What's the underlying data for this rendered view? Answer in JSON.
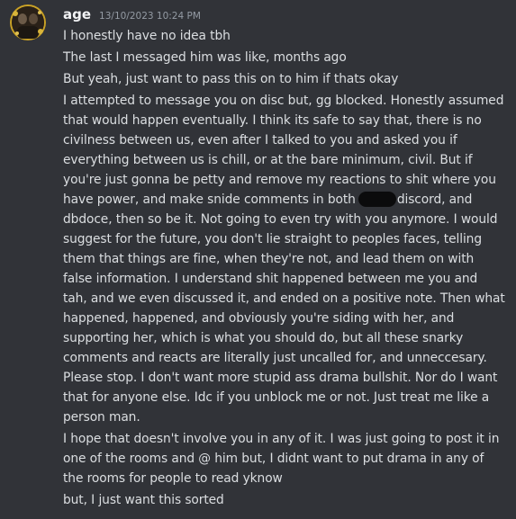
{
  "message": {
    "username": "age",
    "timestamp": "13/10/2023 10:24 PM",
    "avatar_icon": "user-avatar-icon",
    "lines": [
      "I honestly have no idea tbh",
      "The last I messaged him was like, months ago",
      "But yeah, just want to pass this on to him if thats okay"
    ],
    "long_message": {
      "rows": [
        "I attempted to message you on disc but, gg blocked. Honestly assumed",
        "that would happen eventually. I think its safe to say that, there is no",
        "civilness between us, even after I talked to you and asked you if",
        "everything between us is chill, or at the bare minimum, civil. But if",
        "you're just gonna be petty and remove my reactions to shit where you",
        "have power, and make snide comments in both",
        "discord, and",
        "dbdoce, then so be it. Not going to even try with you anymore. I would",
        "suggest for the future, you don't lie straight to peoples faces, telling",
        "them that things are fine, when they're not, and lead them on with",
        "false information. I understand shit happened between me you and",
        "tah, and we even discussed it, and ended on a positive note. Then what",
        "happened, happened, and obviously you're siding with her, and",
        "supporting her, which is what you should do, but all these snarky",
        "comments and reacts are literally just uncalled for, and unneccesary.",
        "Please stop. I don't want more stupid ass drama bullshit. Nor do I want",
        "that for anyone else. Idc if you unblock me or not. Just treat me like a",
        "person man."
      ]
    },
    "follow_up": [
      "I hope that doesn't involve you in any of it. I was just going to post it in",
      "one of the rooms and @ him but, I didnt want to put drama in any of",
      "the rooms for people to read yknow"
    ],
    "last_line": "but, I just want this sorted"
  },
  "colors": {
    "background": "#313338",
    "text": "#dbdee1",
    "username": "#f2f3f5",
    "timestamp": "#949ba4",
    "avatar_ring": "#c9a227"
  }
}
